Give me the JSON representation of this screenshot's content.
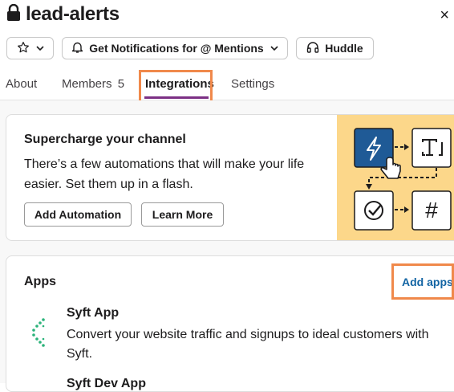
{
  "channel": {
    "name": "lead-alerts",
    "close_glyph": "×"
  },
  "toolbar": {
    "star_chevron": "⌄",
    "notifications_label": "Get Notifications for @ Mentions",
    "huddle_label": "Huddle"
  },
  "tabs": [
    {
      "label": "About"
    },
    {
      "label": "Members",
      "count": "5"
    },
    {
      "label": "Integrations"
    },
    {
      "label": "Settings"
    }
  ],
  "promo": {
    "title": "Supercharge your channel",
    "body": "There’s a few automations that will make your life easier. Set them up in a flash.",
    "add_automation": "Add Automation",
    "learn_more": "Learn More",
    "hash_glyph": "#"
  },
  "apps": {
    "heading": "Apps",
    "add_apps": "Add apps",
    "items": [
      {
        "name": "Syft App",
        "description": "Convert your website traffic and signups to ideal customers with Syft."
      },
      {
        "name": "Syft Dev App"
      }
    ]
  },
  "colors": {
    "accent_highlight": "#f0894b",
    "tab_underline": "#7c3085",
    "link": "#1264a3",
    "promo_bg": "#fcd78a",
    "bolt_tile": "#1f5a96",
    "syft_green": "#2bb37a"
  }
}
